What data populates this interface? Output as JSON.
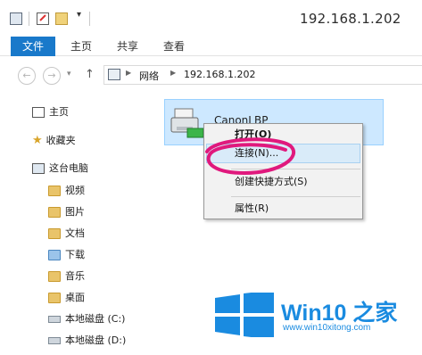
{
  "window": {
    "title": "192.168.1.202"
  },
  "ribbon": {
    "tabs": [
      "文件",
      "主页",
      "共享",
      "查看"
    ]
  },
  "address": {
    "crumbs": [
      "网络",
      "192.168.1.202"
    ]
  },
  "nav": {
    "items": [
      {
        "label": "主页",
        "icon": "home-icon"
      },
      {
        "label": "收藏夹",
        "icon": "star-icon"
      },
      {
        "label": "这台电脑",
        "icon": "computer-icon"
      },
      {
        "label": "视频",
        "icon": "folder-icon"
      },
      {
        "label": "图片",
        "icon": "folder-icon"
      },
      {
        "label": "文档",
        "icon": "folder-icon"
      },
      {
        "label": "下载",
        "icon": "download-folder-icon"
      },
      {
        "label": "音乐",
        "icon": "folder-icon"
      },
      {
        "label": "桌面",
        "icon": "folder-icon"
      },
      {
        "label": "本地磁盘 (C:)",
        "icon": "drive-icon"
      },
      {
        "label": "本地磁盘 (D:)",
        "icon": "drive-icon"
      }
    ]
  },
  "content": {
    "device_name": "CanonLBP"
  },
  "context_menu": {
    "items": [
      "打开(O)",
      "连接(N)...",
      "创建快捷方式(S)",
      "属性(R)"
    ],
    "highlighted_index": 1
  },
  "watermark": {
    "brand": "Win10 之家",
    "url": "www.win10xitong.com"
  },
  "colors": {
    "accent": "#1979ca",
    "highlight": "#cde8ff",
    "annotation": "#e0197d"
  }
}
